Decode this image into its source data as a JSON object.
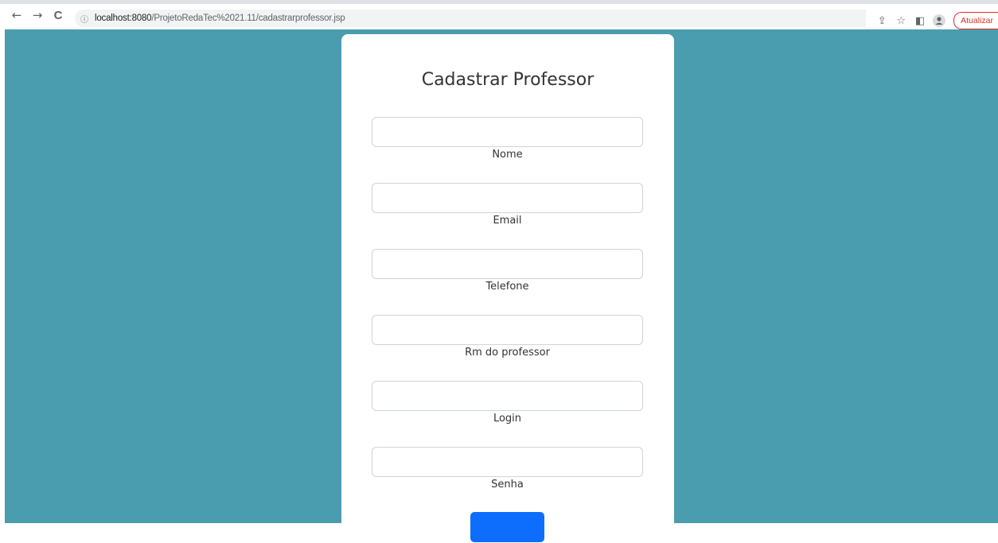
{
  "browser": {
    "back_icon": "←",
    "forward_icon": "→",
    "reload_icon": "C",
    "info_icon": "ⓘ",
    "url_host": "localhost:8080",
    "url_path": "/ProjetoRedaTec%2021.11/cadastrarprofessor.jsp",
    "share_icon": "⇪",
    "star_icon": "☆",
    "sidepanel_icon": "◧",
    "profile_icon": "●",
    "update_label": "Atualizar"
  },
  "form": {
    "title": "Cadastrar Professor",
    "fields": [
      {
        "label": "Nome",
        "value": ""
      },
      {
        "label": "Email",
        "value": ""
      },
      {
        "label": "Telefone",
        "value": ""
      },
      {
        "label": "Rm do professor",
        "value": ""
      },
      {
        "label": "Login",
        "value": ""
      },
      {
        "label": "Senha",
        "value": ""
      }
    ],
    "submit_color": "#0d6efd"
  },
  "colors": {
    "background": "#4a9dae",
    "card": "#ffffff",
    "update_accent": "#d93025"
  }
}
